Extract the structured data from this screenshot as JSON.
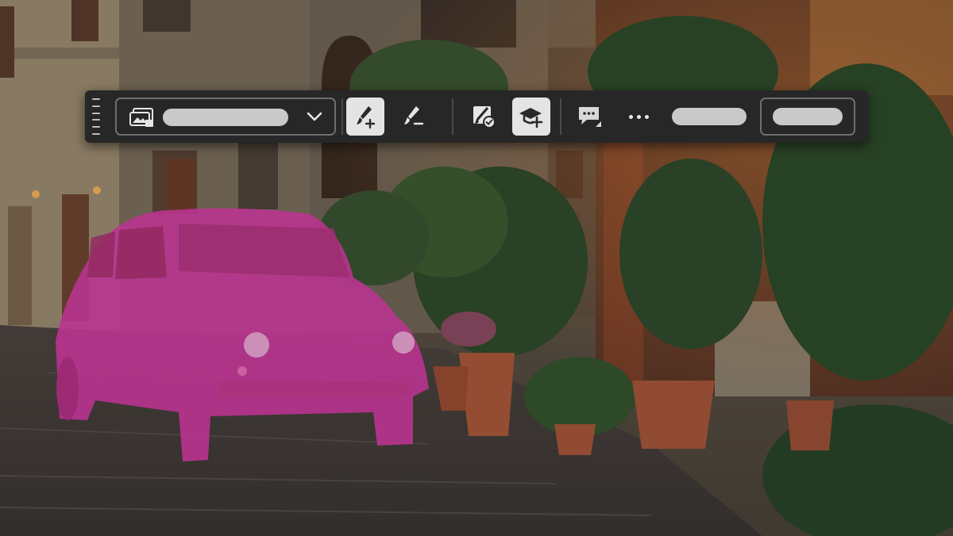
{
  "toolbar": {
    "select": {
      "value": "",
      "icon": "layer-mask-icon"
    },
    "tools": [
      {
        "name": "add-brush",
        "icon": "brush-plus-icon",
        "active": true
      },
      {
        "name": "subtract-brush",
        "icon": "brush-minus-icon",
        "active": false
      },
      {
        "name": "refine-selection",
        "icon": "brush-check-icon",
        "active": false
      },
      {
        "name": "add-mask",
        "icon": "hat-plus-icon",
        "active": true
      },
      {
        "name": "feedback",
        "icon": "speech-bubble-icon",
        "active": false
      }
    ],
    "more_icon": "more-horizontal-icon",
    "primary_button_label": "",
    "secondary_button_label": ""
  },
  "colors": {
    "toolbar_bg": "#272727",
    "active_tool_bg": "#e4e4e4",
    "placeholder_pill": "#c9c9c9",
    "selection_overlay": "#e23fb0"
  }
}
